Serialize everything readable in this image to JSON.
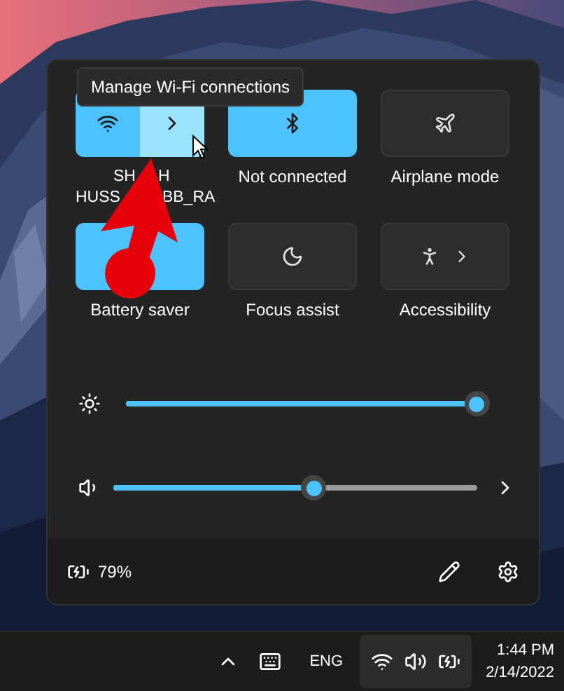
{
  "tooltip": "Manage Wi-Fi connections",
  "tiles": [
    {
      "kind": "wifi",
      "label_lines": [
        [
          "SH",
          "H"
        ],
        [
          "HUSS",
          "BB_RA"
        ]
      ],
      "on": true
    },
    {
      "kind": "bluetooth",
      "label": "Not connected",
      "on": true
    },
    {
      "kind": "airplane",
      "label": "Airplane mode",
      "on": false
    },
    {
      "kind": "battery_saver",
      "label": "Battery saver",
      "on": true
    },
    {
      "kind": "focus",
      "label": "Focus assist",
      "on": false
    },
    {
      "kind": "accessibility",
      "label": "Accessibility",
      "on": false
    }
  ],
  "sliders": [
    {
      "kind": "brightness",
      "level": 0.965
    },
    {
      "kind": "volume",
      "level": 0.55
    }
  ],
  "battery": "79%",
  "taskbar": {
    "language": "ENG",
    "time": "1:44 PM",
    "date": "2/14/2022"
  }
}
